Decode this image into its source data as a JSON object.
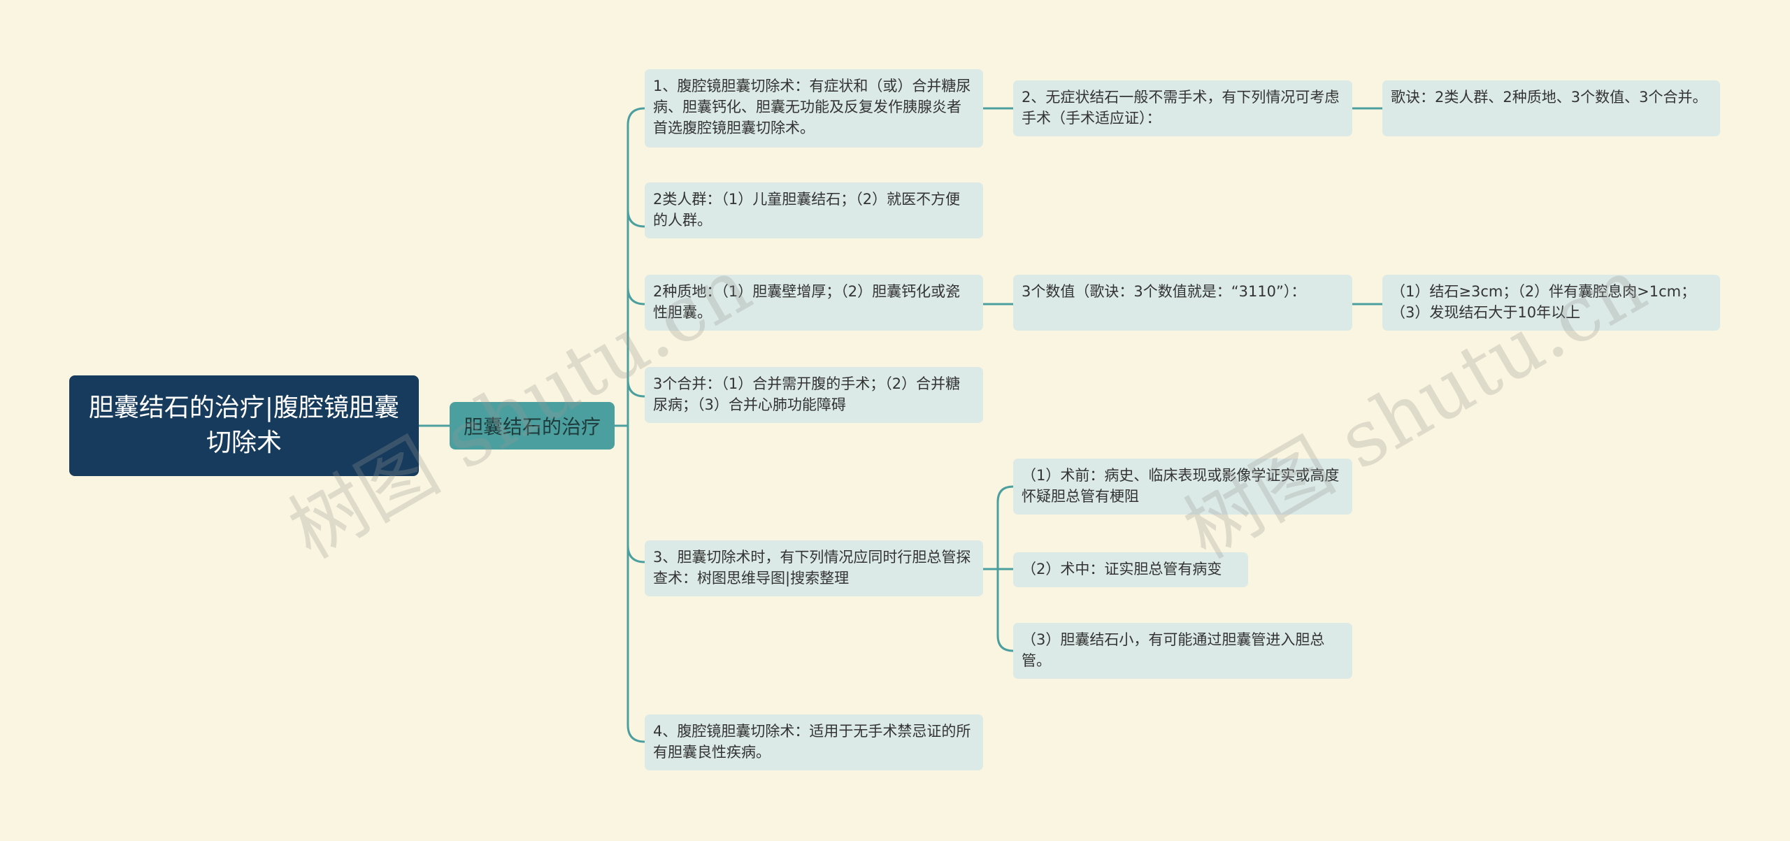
{
  "root": {
    "title": "胆囊结石的治疗|腹腔镜胆囊切除术"
  },
  "hub": {
    "title": "胆囊结石的治疗"
  },
  "items": [
    {
      "text": "1、腹腔镜胆囊切除术：有症状和（或）合并糖尿病、胆囊钙化、胆囊无功能及反复发作胰腺炎者首选腹腔镜胆囊切除术。"
    },
    {
      "text": "2类人群：（1）儿童胆囊结石；（2）就医不方便的人群。"
    },
    {
      "text": "2种质地：（1）胆囊壁增厚；（2）胆囊钙化或瓷性胆囊。"
    },
    {
      "text": "3个合并：（1）合并需开腹的手术；（2）合并糖尿病；（3）合并心肺功能障碍"
    },
    {
      "text": "3、胆囊切除术时，有下列情况应同时行胆总管探查术：树图思维导图|搜索整理"
    },
    {
      "text": "4、腹腔镜胆囊切除术：适用于无手术禁忌证的所有胆囊良性疾病。"
    }
  ],
  "item1_children": [
    {
      "text": "2、无症状结石一般不需手术，有下列情况可考虑手术（手术适应证）："
    }
  ],
  "item1_grandchildren": [
    {
      "text": "歌诀：2类人群、2种质地、3个数值、3个合并。"
    }
  ],
  "item3_children": [
    {
      "text": "3个数值（歌诀：3个数值就是：“3110”）："
    }
  ],
  "item3_grandchildren": [
    {
      "text": "（1）结石≥3cm；（2）伴有囊腔息肉>1cm；（3）发现结石大于10年以上"
    }
  ],
  "item5_children": [
    {
      "text": "（1）术前：病史、临床表现或影像学证实或高度怀疑胆总管有梗阻"
    },
    {
      "text": "（2）术中：证实胆总管有病变"
    },
    {
      "text": "（3）胆囊结石小，有可能通过胆囊管进入胆总管。"
    }
  ],
  "watermarks": [
    "树图 shutu.cn",
    "树图 shutu.cn"
  ],
  "colors": {
    "background": "#faf5e0",
    "root": "#173b5c",
    "hub": "#4ba09f",
    "leaf": "#dbeae6",
    "connector": "#4ba09f"
  }
}
